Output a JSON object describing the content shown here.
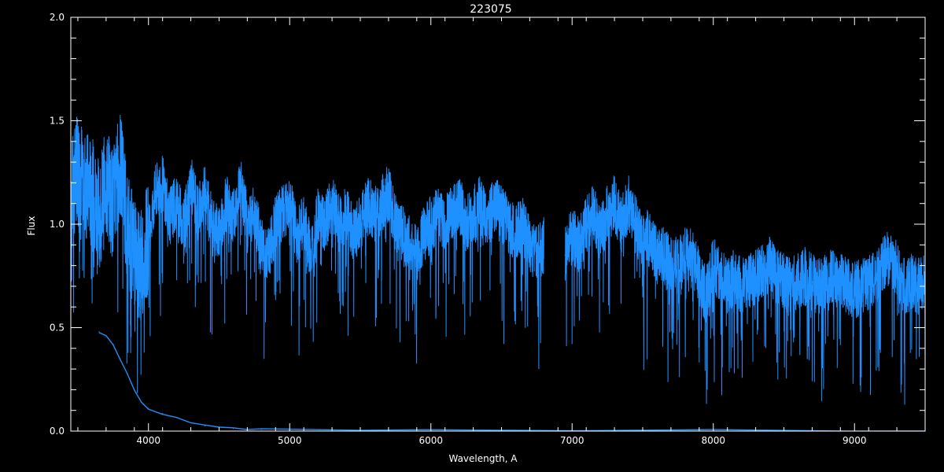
{
  "chart_data": {
    "type": "line",
    "title": "223075",
    "xlabel": "Wavelength, A",
    "ylabel": "Flux",
    "xlim": [
      3450,
      9500
    ],
    "ylim": [
      0.0,
      2.0
    ],
    "x_ticks": [
      "4000",
      "5000",
      "6000",
      "7000",
      "8000",
      "9000"
    ],
    "y_ticks": [
      "0.0",
      "0.5",
      "1.0",
      "1.5",
      "2.0"
    ],
    "grid": false,
    "colors": {
      "background": "#000000",
      "axes": "#ffffff",
      "series": "#1e90ff"
    },
    "series": [
      {
        "x": [
          3450,
          3500,
          3550,
          3600,
          3650,
          3700,
          3750,
          3800,
          3850,
          3900,
          3950,
          4000,
          4050,
          4100,
          4150,
          4200,
          4250,
          4300,
          4350,
          4400,
          4450,
          4500,
          4550,
          4600,
          4650,
          4700,
          4750,
          4800,
          4850,
          4900,
          4950,
          5000,
          5050,
          5100,
          5150,
          5200,
          5250,
          5300,
          5350,
          5400,
          5450,
          5500,
          5550,
          5600,
          5650,
          5700,
          5750,
          5800,
          5850,
          5900,
          5950,
          6000,
          6050,
          6100,
          6150,
          6200,
          6250,
          6300,
          6350,
          6400,
          6450,
          6500,
          6550,
          6600,
          6650,
          6700,
          6750,
          6800,
          6950,
          7000,
          7050,
          7100,
          7150,
          7200,
          7250,
          7300,
          7350,
          7400,
          7450,
          7500,
          7550,
          7600,
          7650,
          7700,
          7750,
          7800,
          7850,
          7900,
          7950,
          8000,
          8050,
          8100,
          8150,
          8200,
          8250,
          8300,
          8350,
          8400,
          8450,
          8500,
          8550,
          8600,
          8650,
          8700,
          8750,
          8800,
          8850,
          8900,
          8950,
          9000,
          9050,
          9100,
          9150,
          9200,
          9250,
          9300,
          9350,
          9400,
          9450,
          9500
        ],
        "y": [
          1.1,
          1.3,
          1.2,
          1.15,
          1.05,
          1.2,
          1.1,
          1.3,
          1.0,
          0.85,
          0.8,
          0.95,
          1.15,
          1.2,
          1.05,
          1.1,
          1.0,
          1.2,
          1.05,
          1.15,
          1.0,
          0.95,
          1.1,
          1.05,
          1.2,
          1.0,
          1.05,
          0.9,
          0.85,
          1.0,
          1.05,
          1.1,
          0.95,
          1.0,
          0.85,
          1.05,
          1.0,
          1.1,
          1.0,
          1.05,
          0.95,
          1.0,
          1.1,
          1.05,
          1.1,
          1.15,
          1.0,
          0.95,
          0.9,
          0.85,
          0.95,
          1.0,
          1.05,
          1.0,
          1.05,
          1.1,
          1.0,
          1.05,
          1.1,
          1.0,
          1.1,
          1.05,
          1.0,
          0.95,
          1.0,
          0.9,
          0.85,
          0.9,
          0.85,
          0.95,
          0.9,
          1.0,
          1.05,
          0.95,
          1.05,
          1.1,
          1.0,
          1.1,
          1.0,
          0.9,
          0.95,
          0.85,
          0.85,
          0.8,
          0.8,
          0.85,
          0.85,
          0.75,
          0.65,
          0.8,
          0.75,
          0.7,
          0.75,
          0.7,
          0.72,
          0.75,
          0.78,
          0.8,
          0.75,
          0.72,
          0.7,
          0.72,
          0.75,
          0.72,
          0.7,
          0.72,
          0.75,
          0.72,
          0.7,
          0.68,
          0.7,
          0.72,
          0.75,
          0.8,
          0.85,
          0.78,
          0.7,
          0.72,
          0.7,
          0.75
        ]
      },
      {
        "x": [
          3650,
          3700,
          3750,
          3800,
          3850,
          3900,
          3950,
          4000,
          4100,
          4200,
          4300,
          4400,
          4500,
          4600,
          4700,
          4800,
          5000,
          5500,
          6000,
          7000,
          8000,
          9000,
          9500
        ],
        "y": [
          0.48,
          0.46,
          0.42,
          0.35,
          0.28,
          0.2,
          0.14,
          0.11,
          0.085,
          0.065,
          0.04,
          0.025,
          0.015,
          0.012,
          0.01,
          0.008,
          0.007,
          0.005,
          0.004,
          0.003,
          0.003,
          0.003,
          0.003
        ]
      }
    ]
  }
}
